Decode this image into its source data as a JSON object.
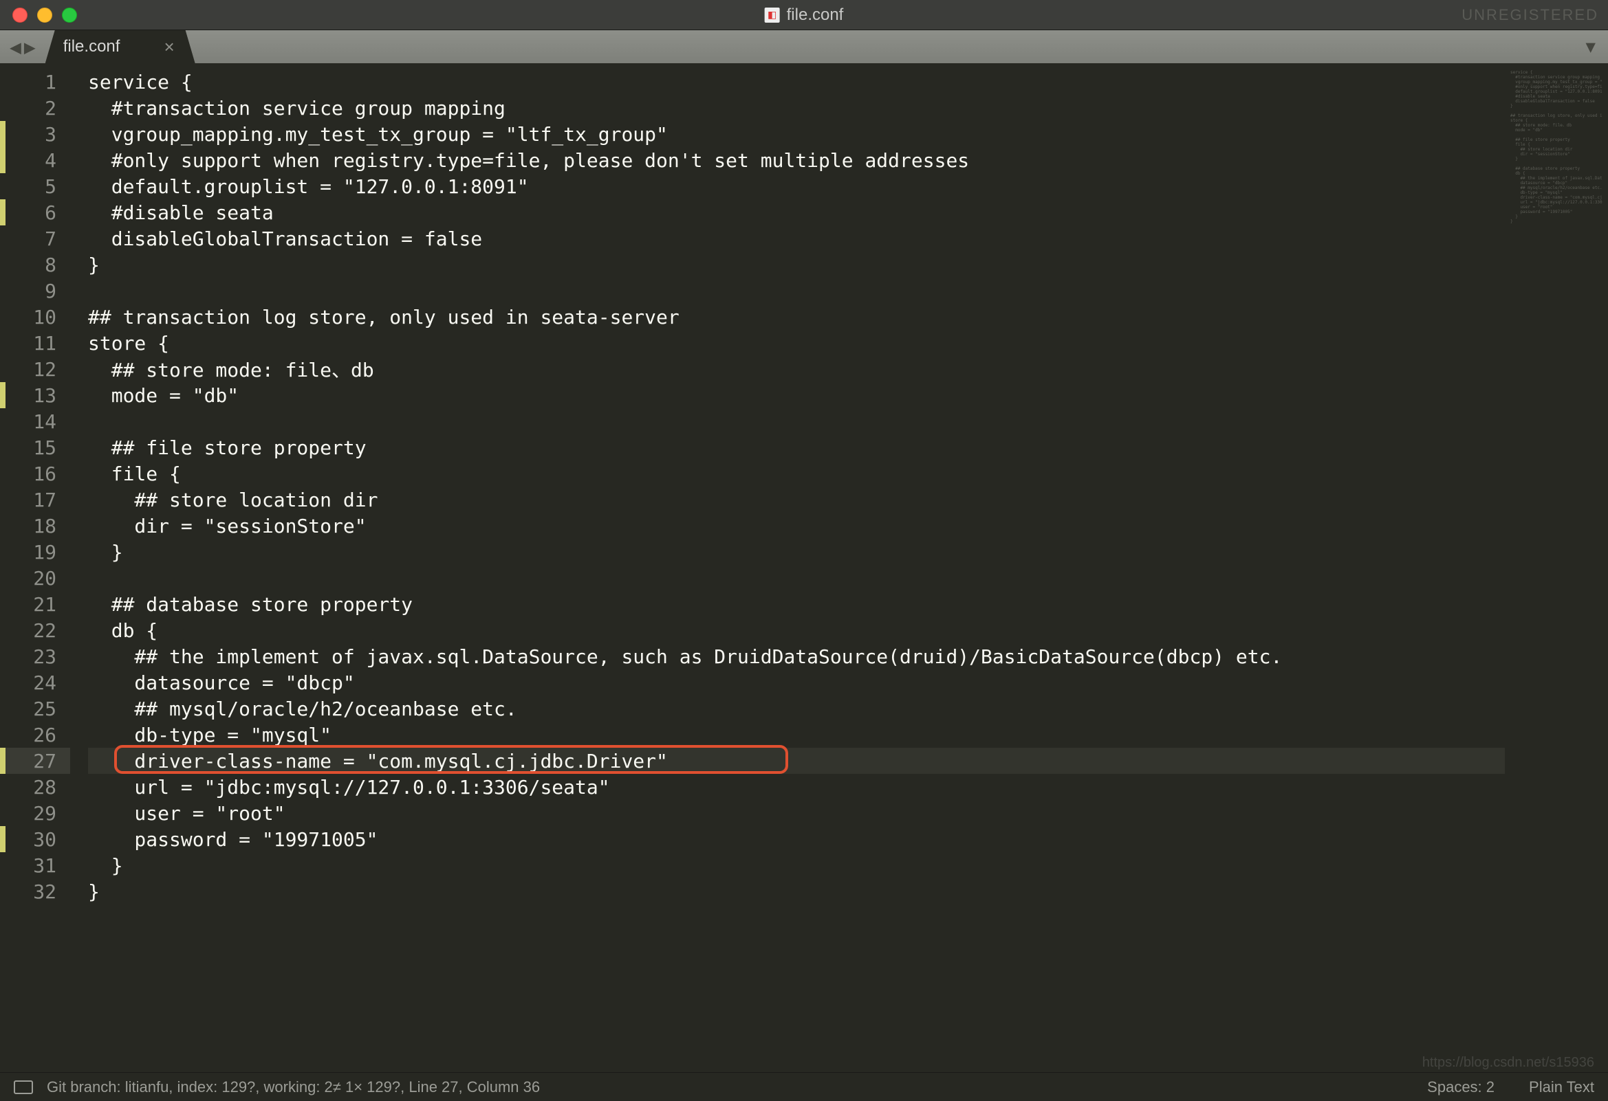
{
  "titlebar": {
    "filename": "file.conf",
    "unregistered": "UNREGISTERED"
  },
  "tabs": {
    "active": {
      "label": "file.conf"
    }
  },
  "gutter": {
    "lines": [
      "1",
      "2",
      "3",
      "4",
      "5",
      "6",
      "7",
      "8",
      "9",
      "10",
      "11",
      "12",
      "13",
      "14",
      "15",
      "16",
      "17",
      "18",
      "19",
      "20",
      "21",
      "22",
      "23",
      "24",
      "25",
      "26",
      "27",
      "28",
      "29",
      "30",
      "31",
      "32"
    ],
    "marked": [
      3,
      4,
      6,
      13,
      27,
      30
    ],
    "active": 27
  },
  "code": {
    "lines": [
      "service {",
      "  #transaction service group mapping",
      "  vgroup_mapping.my_test_tx_group = \"ltf_tx_group\"",
      "  #only support when registry.type=file, please don't set multiple addresses",
      "  default.grouplist = \"127.0.0.1:8091\"",
      "  #disable seata",
      "  disableGlobalTransaction = false",
      "}",
      "",
      "## transaction log store, only used in seata-server",
      "store {",
      "  ## store mode: file、db",
      "  mode = \"db\"",
      "",
      "  ## file store property",
      "  file {",
      "    ## store location dir",
      "    dir = \"sessionStore\"",
      "  }",
      "",
      "  ## database store property",
      "  db {",
      "    ## the implement of javax.sql.DataSource, such as DruidDataSource(druid)/BasicDataSource(dbcp) etc.",
      "    datasource = \"dbcp\"",
      "    ## mysql/oracle/h2/oceanbase etc.",
      "    db-type = \"mysql\"",
      "    driver-class-name = \"com.mysql.cj.jdbc.Driver\"",
      "    url = \"jdbc:mysql://127.0.0.1:3306/seata\"",
      "    user = \"root\"",
      "    password = \"19971005\"",
      "  }",
      "}"
    ],
    "highlighted_line_index": 26
  },
  "statusbar": {
    "left": "Git branch: litianfu, index: 129?, working: 2≠ 1× 129?, Line 27, Column 36",
    "spaces": "Spaces: 2",
    "syntax": "Plain Text"
  },
  "watermark": "https://blog.csdn.net/s15936"
}
